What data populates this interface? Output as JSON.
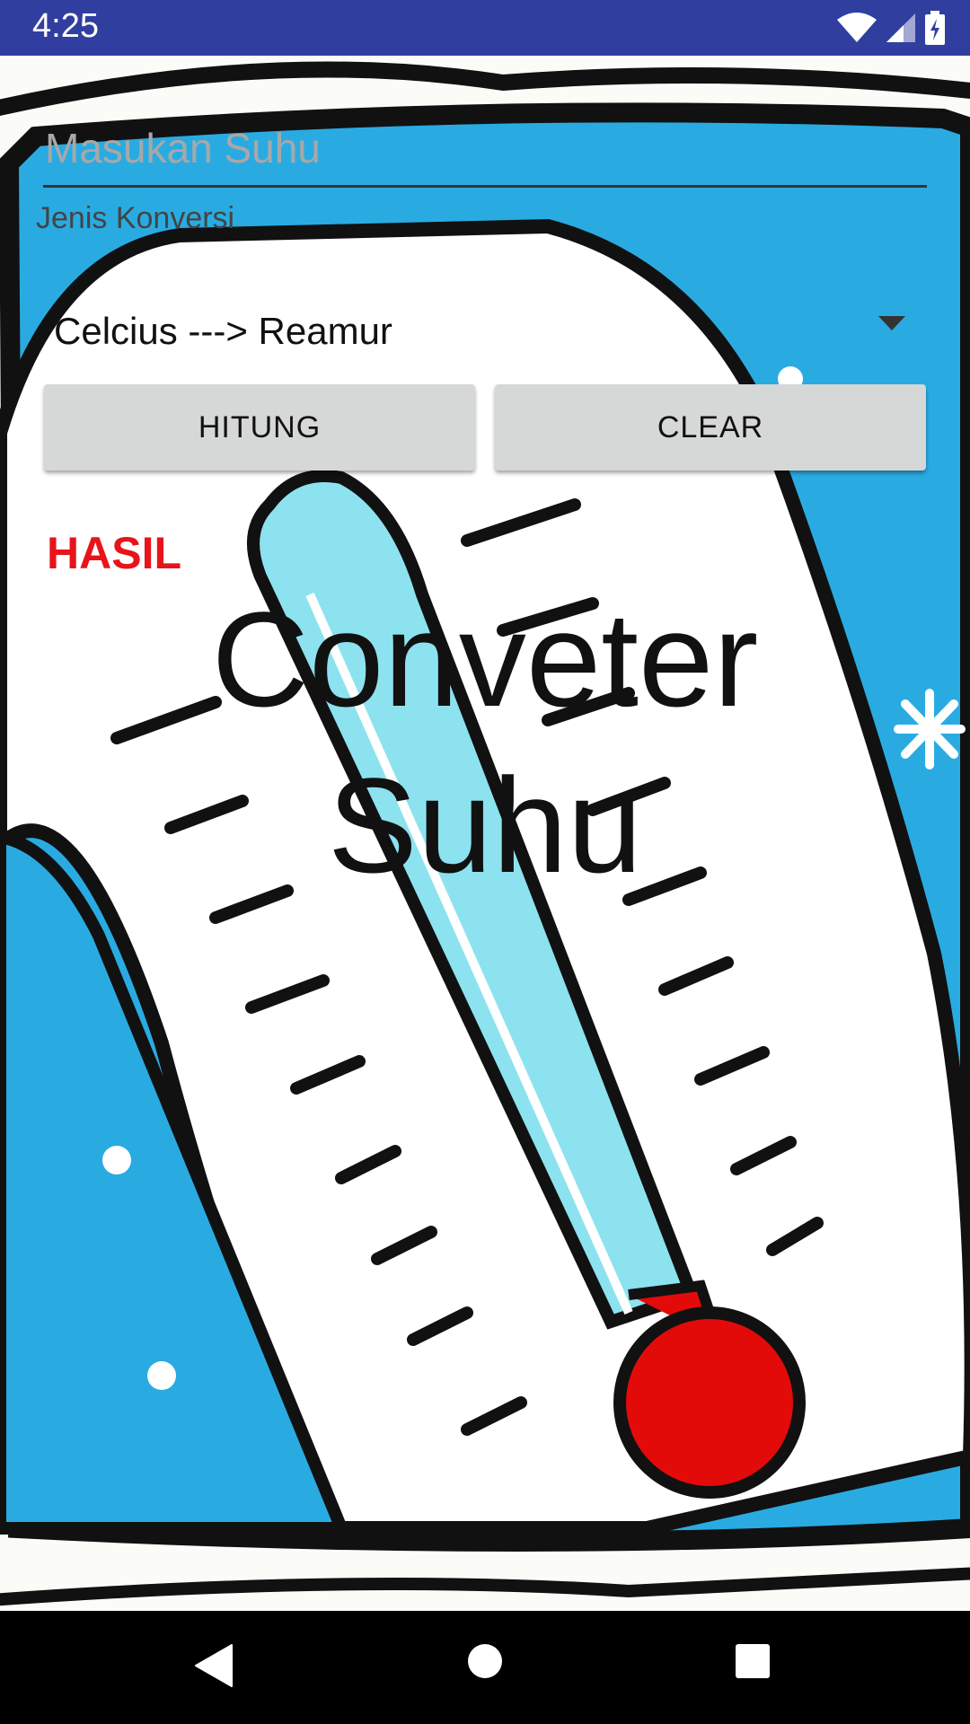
{
  "status_bar": {
    "time": "4:25",
    "icons": [
      "wifi-icon",
      "cell-signal-icon",
      "battery-charging-icon"
    ]
  },
  "form": {
    "suhu_input": {
      "value": "",
      "placeholder": "Masukan Suhu"
    },
    "jenis_label": "Jenis Konversi",
    "spinner": {
      "selected": "Celcius ---> Reamur"
    },
    "buttons": {
      "hitung": "HITUNG",
      "clear": "CLEAR"
    },
    "hasil_label": "HASIL"
  },
  "title": {
    "line1": "Conveter",
    "line2": "Suhu"
  },
  "nav_bar": {
    "buttons": [
      "back-icon",
      "home-icon",
      "recents-icon"
    ]
  },
  "colors": {
    "status_bar": "#303f9f",
    "hasil": "#e8141b",
    "button": "#d6d7d7",
    "background_blue": "#29abe2",
    "mercury_red": "#e30a0a",
    "thermometer_tube": "#8de2ef"
  }
}
